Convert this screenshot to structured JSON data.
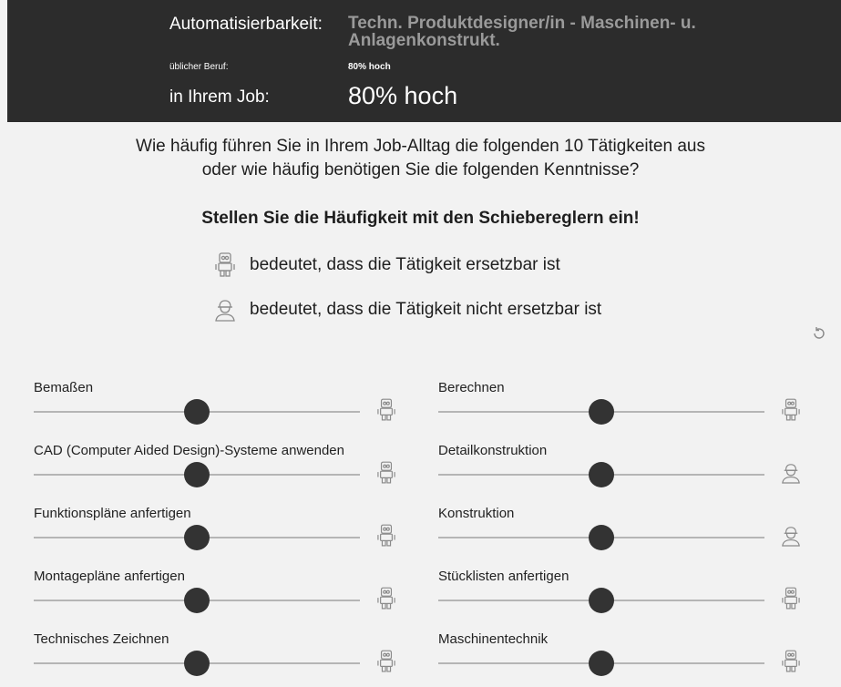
{
  "header": {
    "automation_label": "Automatisierbarkeit:",
    "job_title": "Techn. Produktdesigner/in - Maschinen- u. Anlagenkonstrukt.",
    "usual_job_label": "üblicher Beruf:",
    "usual_job_value": "80% hoch",
    "your_job_label": "in Ihrem Job:",
    "your_job_value": "80% hoch"
  },
  "intro": {
    "question_line1": "Wie häufig führen Sie in Ihrem Job-Alltag die folgenden 10 Tätigkeiten aus",
    "question_line2": "oder wie häufig benötigen Sie die folgenden Kenntnisse?",
    "instruction": "Stellen Sie die Häufigkeit mit den Schiebereglern ein!",
    "legend_robot": "bedeutet, dass die Tätigkeit ersetzbar ist",
    "legend_human": "bedeutet, dass die Tätigkeit nicht ersetzbar ist"
  },
  "reset_icon": "reset-icon",
  "sliders": [
    {
      "label": "Bemaßen",
      "value": 0.5,
      "icon": "robot"
    },
    {
      "label": "Berechnen",
      "value": 0.5,
      "icon": "robot"
    },
    {
      "label": "CAD (Computer Aided Design)-Systeme anwenden",
      "value": 0.5,
      "icon": "robot"
    },
    {
      "label": "Detailkonstruktion",
      "value": 0.5,
      "icon": "human"
    },
    {
      "label": "Funktionspläne anfertigen",
      "value": 0.5,
      "icon": "robot"
    },
    {
      "label": "Konstruktion",
      "value": 0.5,
      "icon": "human"
    },
    {
      "label": "Montagepläne anfertigen",
      "value": 0.5,
      "icon": "robot"
    },
    {
      "label": "Stücklisten anfertigen",
      "value": 0.5,
      "icon": "robot"
    },
    {
      "label": "Technisches Zeichnen",
      "value": 0.5,
      "icon": "robot"
    },
    {
      "label": "Maschinentechnik",
      "value": 0.5,
      "icon": "robot"
    }
  ]
}
